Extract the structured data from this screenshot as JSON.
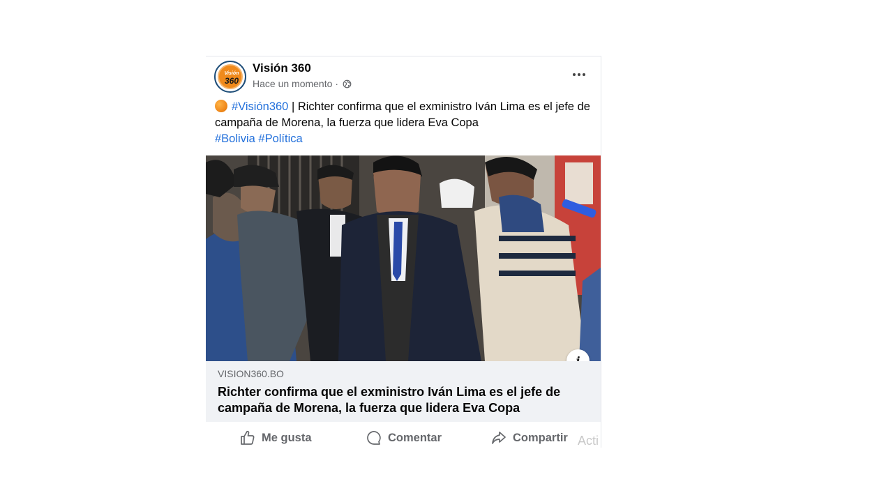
{
  "post": {
    "page_name": "Visión 360",
    "timestamp": "Hace un momento",
    "separator": "·",
    "avatar_top": "Visión",
    "avatar_bottom": "360",
    "text": {
      "hashtag_main": "#Visión360",
      "body": " | Richter confirma que el exministro Iván Lima es el jefe de campaña de Morena, la fuerza que lidera Eva Copa",
      "hashtag_bolivia": "#Bolivia",
      "hashtag_politica": "#Política"
    },
    "link": {
      "domain": "VISION360.BO",
      "title": "Richter confirma que el exministro Iván Lima es el jefe de campaña de Morena, la fuerza que lidera Eva Copa"
    },
    "actions": {
      "like": "Me gusta",
      "comment": "Comentar",
      "share": "Compartir"
    },
    "info_label": "i"
  },
  "watermark": "Acti",
  "colors": {
    "hashtag": "#216fdb",
    "secondary_text": "#65676b",
    "preview_bg": "#f0f2f5",
    "brand_orange": "#f08a1c"
  }
}
